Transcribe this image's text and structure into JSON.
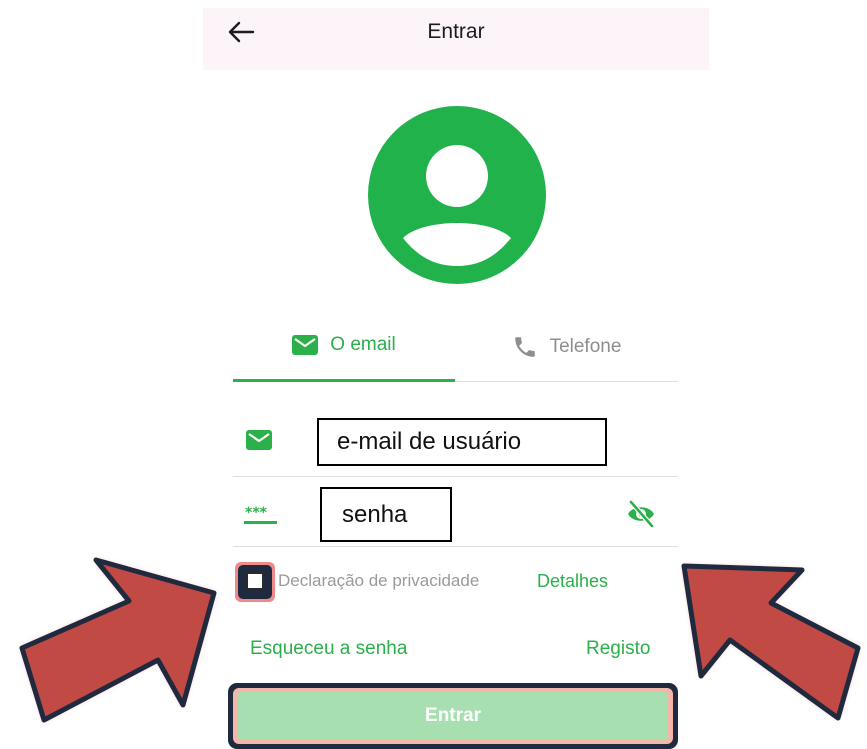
{
  "header": {
    "title": "Entrar",
    "back_icon": "arrow-left-icon"
  },
  "avatar": {
    "icon": "user-circle-icon",
    "color": "#22b24c"
  },
  "tabs": [
    {
      "label": "O email",
      "icon": "envelope-icon",
      "selected": true
    },
    {
      "label": "Telefone",
      "icon": "phone-icon",
      "selected": false
    }
  ],
  "form": {
    "email": {
      "value": "e-mail de usuário",
      "icon": "envelope-icon"
    },
    "password": {
      "value": "senha",
      "icon": "password-dots-icon",
      "toggle_icon": "eye-off-icon"
    }
  },
  "privacy": {
    "checked": false,
    "text": "Declaração de privacidade",
    "details_label": "Detalhes"
  },
  "links": {
    "forgot": "Esqueceu a senha",
    "register": "Registo"
  },
  "login_button": {
    "label": "Entrar"
  },
  "colors": {
    "accent": "#2bb04a",
    "header_bg": "#fcf4f8",
    "button_bg": "#a8dfb1",
    "arrow_fill": "#c24a45",
    "arrow_stroke": "#1f2a3f",
    "highlight": "#ee8a8a"
  }
}
